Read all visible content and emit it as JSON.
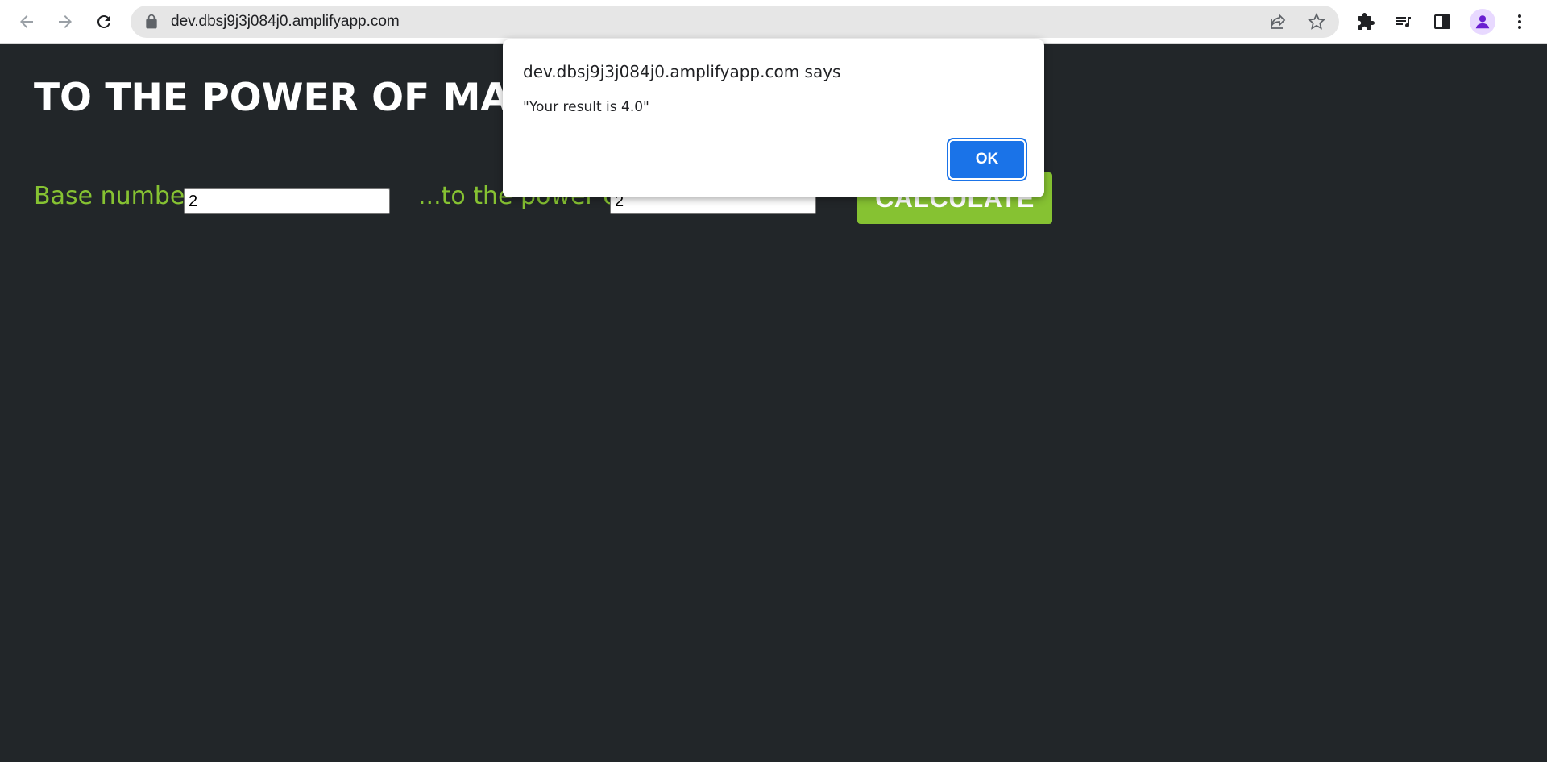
{
  "browser": {
    "url": "dev.dbsj9j3j084j0.amplifyapp.com",
    "icons": {
      "back": "back-arrow-icon",
      "forward": "forward-arrow-icon",
      "reload": "reload-icon",
      "lock": "lock-icon",
      "share": "share-icon",
      "bookmark": "star-icon",
      "extensions": "puzzle-icon",
      "media": "media-queue-icon",
      "side_panel": "side-panel-icon",
      "profile": "profile-avatar-icon",
      "menu": "kebab-menu-icon"
    }
  },
  "page": {
    "title": "TO THE POWER OF MATH!",
    "base_label": "Base number:",
    "base_value": "2",
    "exponent_label": "...to the power of:",
    "exponent_value": "2",
    "calculate_label": "CALCULATE"
  },
  "dialog": {
    "origin": "dev.dbsj9j3j084j0.amplifyapp.com says",
    "message": "\"Your result is 4.0\"",
    "ok_label": "OK"
  },
  "colors": {
    "page_background": "#222629",
    "accent_green": "#86c232",
    "dialog_button": "#1a73e8"
  }
}
